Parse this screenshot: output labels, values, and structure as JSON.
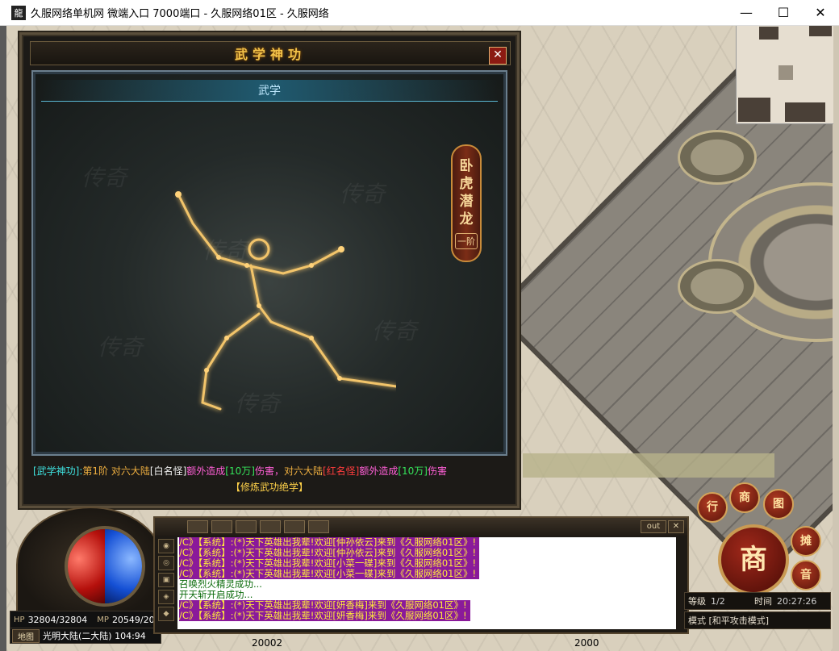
{
  "window": {
    "icon_text": "龍",
    "title": "久服网络单机网 微端入口 7000端口 - 久服网络01区 - 久服网络",
    "minimize": "—",
    "maximize": "☐",
    "close": "✕"
  },
  "dialog": {
    "title": "武学神功",
    "close": "✕",
    "tab_label": "武学",
    "plaque_text": [
      "卧",
      "虎",
      "潜",
      "龙"
    ],
    "plaque_rank": "一阶",
    "watermark": "传奇",
    "desc": {
      "part1": "[武学神功]:",
      "part2": "第1阶",
      "part3": "对六大陆",
      "part4": "[白名怪]",
      "part5": "额外造成",
      "part6": "[10万]",
      "part7": "伤害，",
      "part8": "对六大陆",
      "part9": "[红名怪]",
      "part10": "额外造成",
      "part11": "[10万]",
      "part12": "伤害"
    },
    "learn_link": "【修炼武功绝学】"
  },
  "hud": {
    "hp_label": "HP",
    "hp_value": "32804/32804",
    "mp_label": "MP",
    "mp_value": "20549/20549",
    "map_button": "地图",
    "map_name": "光明大陆(二大陆) 104:94",
    "chat_out": "out",
    "chat_close": "✕",
    "chat_messages": [
      {
        "type": "sys",
        "text": "/C》【系统】:(*)天下英雄出我辈!欢迎[仲孙依云]来到《久服网络01区》!"
      },
      {
        "type": "sys",
        "text": "/C》【系统】:(*)天下英雄出我辈!欢迎[仲孙依云]来到《久服网络01区》!"
      },
      {
        "type": "sys",
        "text": "/C》【系统】:(*)天下英雄出我辈!欢迎[小菜一碟]来到《久服网络01区》!"
      },
      {
        "type": "sys",
        "text": "/C》【系统】:(*)天下英雄出我辈!欢迎[小菜一碟]来到《久服网络01区》!"
      },
      {
        "type": "plain",
        "text": "召唤烈火精灵成功..."
      },
      {
        "type": "plain",
        "text": "开天斩开启成功..."
      },
      {
        "type": "sys",
        "text": "/C》【系统】:(*)天下英雄出我辈!欢迎[妍香梅]来到《久服网络01区》!"
      },
      {
        "type": "sys",
        "text": "/C》【系统】:(*)天下英雄出我辈!欢迎[妍香梅]来到《久服网络01区》!"
      }
    ],
    "level_label": "等级",
    "level_value": "1/2",
    "time_label": "时间",
    "time_value": "20:27:26",
    "mode": "模式 [和平攻击模式]",
    "shop_label": "商",
    "btn_stall": "摊",
    "btn_sound": "音",
    "btn_a": "行",
    "btn_b": "商",
    "btn_c": "图"
  },
  "bg_numbers": [
    "20002",
    "2000"
  ]
}
